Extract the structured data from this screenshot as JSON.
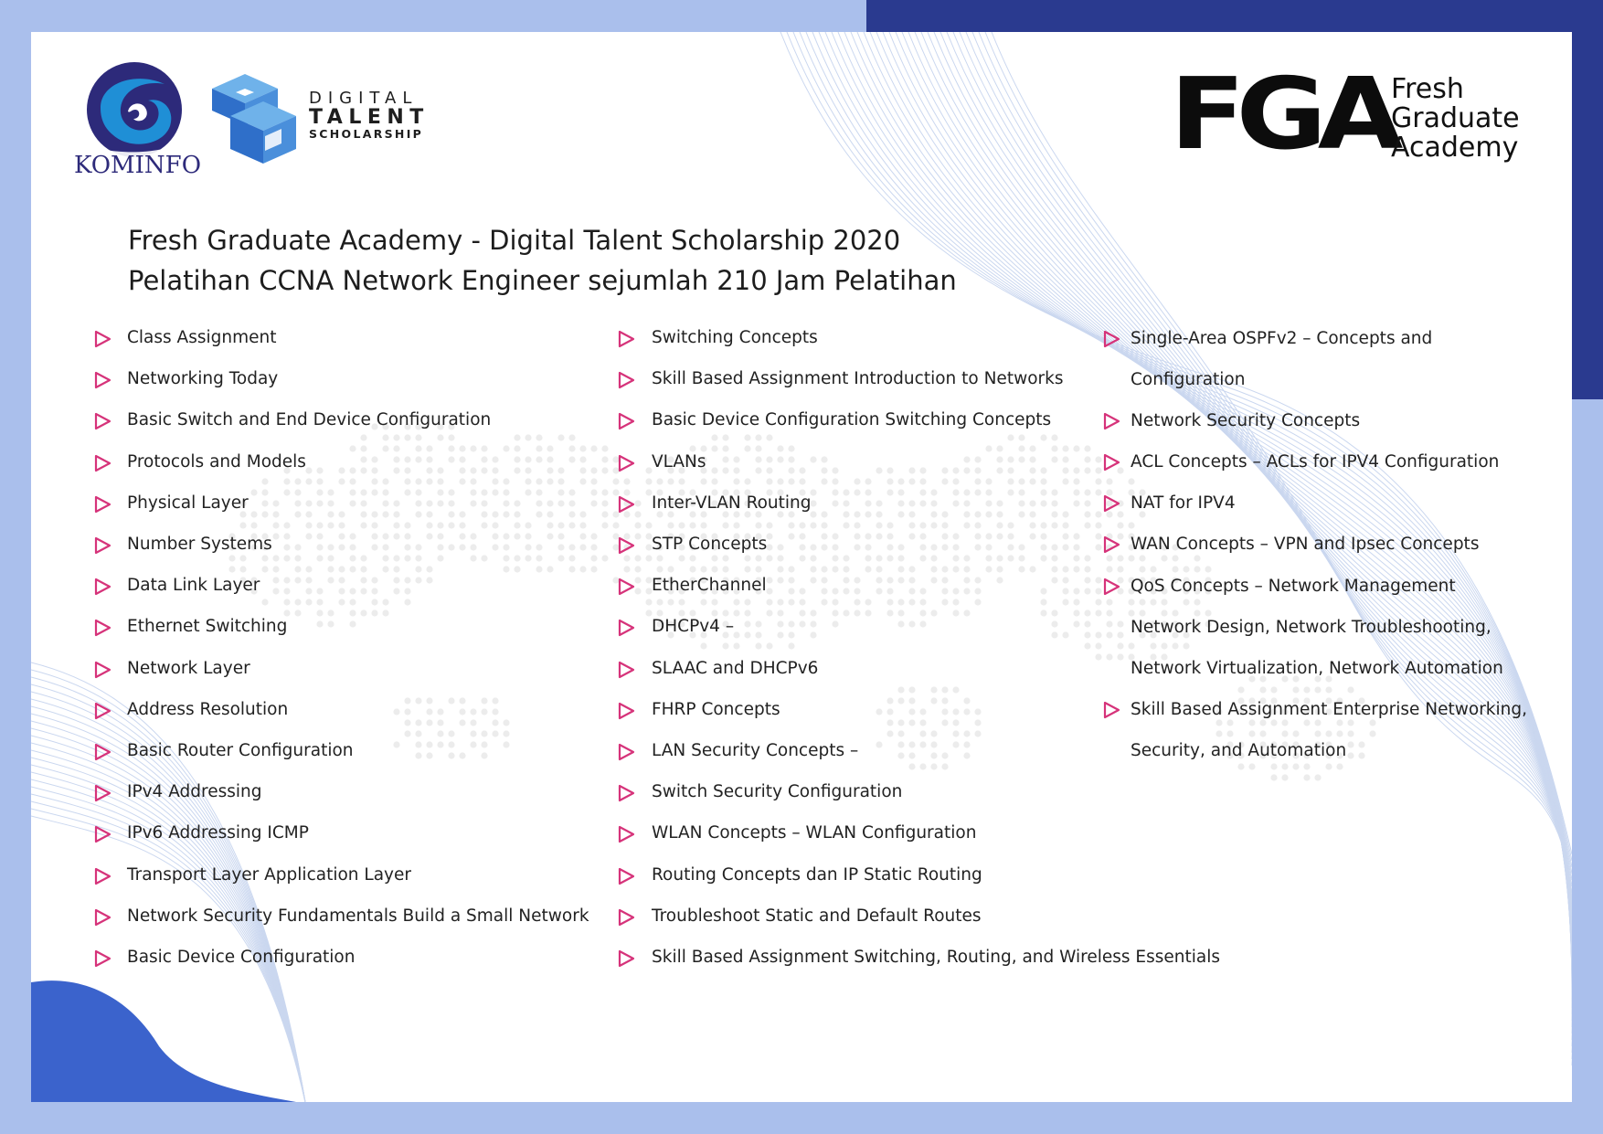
{
  "colors": {
    "background": "#aabfec",
    "navy_band": "#2a3a8f",
    "accent_blue": "#3b63cc",
    "bullet_pink": "#d6337a",
    "text": "#222222"
  },
  "header": {
    "kominfo_label": "KOMINFO",
    "dts_line1": "DIGITAL",
    "dts_line2": "TALENT",
    "dts_line3": "SCHOLARSHIP",
    "fga_mark": "FGA",
    "fga_name_1": "Fresh",
    "fga_name_2": "Graduate",
    "fga_name_3": "Academy"
  },
  "title": {
    "line1": "Fresh Graduate Academy - Digital Talent Scholarship 2020",
    "line2": "Pelatihan CCNA Network Engineer sejumlah 210 Jam Pelatihan"
  },
  "icons": {
    "bullet": "play-outline-icon"
  },
  "col1": [
    "Class Assignment",
    "Networking Today",
    "Basic Switch and End Device Configuration",
    "Protocols and Models",
    "Physical Layer",
    "Number Systems",
    "Data Link Layer",
    "Ethernet Switching",
    "Network Layer",
    "Address Resolution",
    "Basic Router Configuration",
    "IPv4 Addressing",
    "IPv6 Addressing ICMP",
    "Transport Layer Application Layer",
    "Network Security Fundamentals Build a Small Network",
    "Basic Device Configuration"
  ],
  "col2": [
    "Switching Concepts",
    "Skill Based Assignment Introduction to Networks",
    "Basic Device Configuration Switching Concepts",
    "VLANs",
    "Inter-VLAN Routing",
    "STP Concepts",
    "EtherChannel",
    "DHCPv4 –",
    "SLAAC and DHCPv6",
    "FHRP Concepts",
    "LAN Security Concepts –",
    "Switch Security Configuration",
    "WLAN Concepts – WLAN Configuration",
    "Routing Concepts dan IP Static Routing",
    "Troubleshoot Static and Default Routes",
    "Skill Based Assignment Switching, Routing, and Wireless Essentials"
  ],
  "col3": {
    "item1_line1": "Single-Area OSPFv2 – Concepts and",
    "item1_line2": "Configuration",
    "item2": "Network Security Concepts",
    "item3": "ACL Concepts – ACLs for IPV4 Configuration",
    "item4": "NAT for IPV4",
    "item5": "WAN Concepts – VPN and Ipsec Concepts",
    "item6": "QoS Concepts – Network Management",
    "cont1": "Network Design, Network Troubleshooting,",
    "cont2": "Network Virtualization, Network Automation",
    "item7_line1": "Skill Based Assignment Enterprise Networking,",
    "item7_line2": "Security, and Automation"
  }
}
